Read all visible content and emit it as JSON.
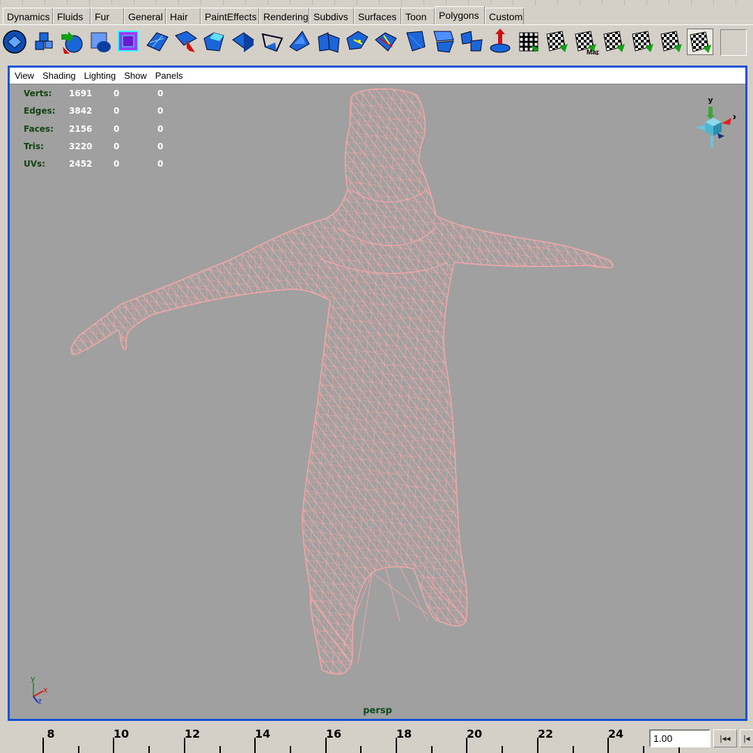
{
  "shelf": {
    "tabs": [
      "Dynamics",
      "Fluids",
      "Fur",
      "General",
      "Hair",
      "PaintEffects",
      "Rendering",
      "Subdivs",
      "Surfaces",
      "Toon",
      "Polygons",
      "Custom"
    ],
    "active_tab": "Polygons",
    "icons": [
      "poly-sphere-icon",
      "extrude-face-icon",
      "poly-cylinder-icon",
      "subdiv-proxy-icon",
      "bevel-cube-icon",
      "smooth-icon",
      "split-polygon-icon",
      "extrude-edge-icon",
      "poly-plane-icon",
      "create-polygon-icon",
      "poke-face-icon",
      "merge-icon",
      "wedge-face-icon",
      "collapse-icon",
      "append-polygon-icon",
      "sculpt-icon",
      "separate-icon",
      "combine-icon",
      "move-uv-icon",
      "planar-map-icon",
      "automatic-map-icon",
      "cylindrical-map-icon",
      "spherical-map-icon",
      "layout-uvs-icon",
      "uv-texture-editor-icon"
    ],
    "automatic_map_label": "Map"
  },
  "viewport": {
    "menus": [
      "View",
      "Shading",
      "Lighting",
      "Show",
      "Panels"
    ],
    "hud": [
      {
        "label": "Verts:",
        "values": [
          "1691",
          "0",
          "0"
        ]
      },
      {
        "label": "Edges:",
        "values": [
          "3842",
          "0",
          "0"
        ]
      },
      {
        "label": "Faces:",
        "values": [
          "2156",
          "0",
          "0"
        ]
      },
      {
        "label": "Tris:",
        "values": [
          "3220",
          "0",
          "0"
        ]
      },
      {
        "label": "UVs:",
        "values": [
          "2452",
          "0",
          "0"
        ]
      }
    ],
    "camera": "persp",
    "wire_color": "#f7a7a7",
    "background_color": "#a0a0a0",
    "frame_color": "#1252d6",
    "view_cube_axes": [
      "y",
      "x"
    ],
    "axis_labels": [
      "y",
      "x",
      "z"
    ]
  },
  "timeline": {
    "tick_labels": [
      "8",
      "10",
      "12",
      "14",
      "16",
      "18",
      "20",
      "22",
      "24"
    ],
    "current_time": "1.00",
    "buttons": [
      "|◂◂",
      "|◂"
    ]
  }
}
